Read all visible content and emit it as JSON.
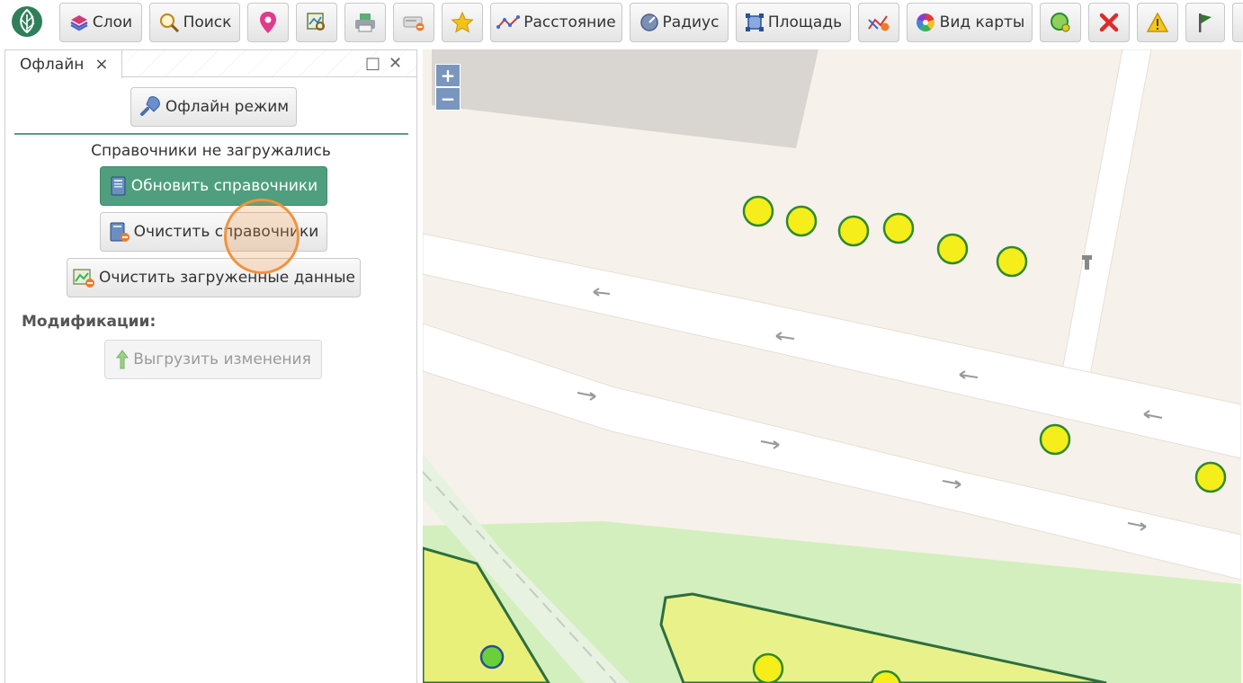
{
  "toolbar": {
    "layers_label": "Слои",
    "search_label": "Поиск",
    "distance_label": "Расстояние",
    "radius_label": "Радиус",
    "area_label": "Площадь",
    "mapview_label": "Вид карты"
  },
  "panel": {
    "tab_label": "Офлайн",
    "tab_close": "×",
    "maximize_glyph": "□",
    "close_glyph": "✕",
    "offline_mode_label": "Офлайн режим",
    "status_text": "Справочники не загружались",
    "update_refs_label": "Обновить справочники",
    "clear_refs_label": "Очистить справочники",
    "clear_loaded_label": "Очистить загруженные данные",
    "modifications_label": "Модификации:",
    "upload_changes_label": "Выгрузить изменения"
  },
  "map": {
    "zoom_in": "+",
    "zoom_out": "−"
  },
  "colors": {
    "accent_green": "#4f9f7e",
    "point_fill": "#f5ee1a",
    "point_stroke": "#2e8a2e",
    "click_highlight": "#f0933f"
  },
  "icons": [
    "logo-leaf-icon",
    "layers-icon",
    "search-icon",
    "map-pin-icon",
    "map-search-icon",
    "printer-icon",
    "eraser-icon",
    "star-icon",
    "distance-icon",
    "radius-icon",
    "area-icon",
    "route-icon",
    "palette-icon",
    "green-circle-icon",
    "red-x-icon",
    "warning-icon",
    "flag-icon",
    "plug-icon",
    "book-icon",
    "book-clear-icon",
    "image-clear-icon",
    "upload-arrow-icon"
  ]
}
